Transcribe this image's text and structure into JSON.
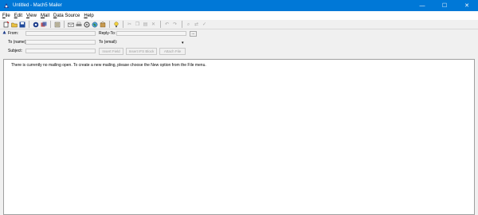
{
  "window": {
    "title": "Untitled - Mach5 Mailer",
    "controls": {
      "minimize": "—",
      "maximize": "☐",
      "close": "✕"
    },
    "accent": "#0078d7"
  },
  "menu": [
    {
      "first": "F",
      "rest": "ile"
    },
    {
      "first": "E",
      "rest": "dit"
    },
    {
      "first": "V",
      "rest": "iew"
    },
    {
      "first": "M",
      "rest": "ail"
    },
    {
      "first": "D",
      "rest": "ata Source"
    },
    {
      "first": "H",
      "rest": "elp"
    }
  ],
  "toolbar": {
    "icons": [
      "new-mailing-icon",
      "open-icon",
      "save-icon",
      "data-source-icon",
      "merge-icon",
      "address-book-icon",
      "send-icon",
      "print-icon",
      "settings-icon",
      "globe-icon",
      "pack-icon",
      "tip-icon",
      "cut-icon",
      "copy-icon",
      "paste-icon",
      "delete-icon",
      "undo-icon",
      "redo-icon",
      "find-icon",
      "replace-icon",
      "spellcheck-icon"
    ]
  },
  "header": {
    "from_label": "From:",
    "to_name_label": "To (name):",
    "subject_label": "Subject:",
    "reply_to_label": "Reply-To:",
    "to_email_label": "To (email):",
    "browse_label": "...",
    "dropdown_arrow": "▾",
    "insert_field": "Insert Field",
    "insert_ifs_block": "Insert IFS Block",
    "attach_file": "Attach File"
  },
  "editor": {
    "message": "There is currently no mailing open. To create a new mailing, please choose the New option from the File menu."
  }
}
